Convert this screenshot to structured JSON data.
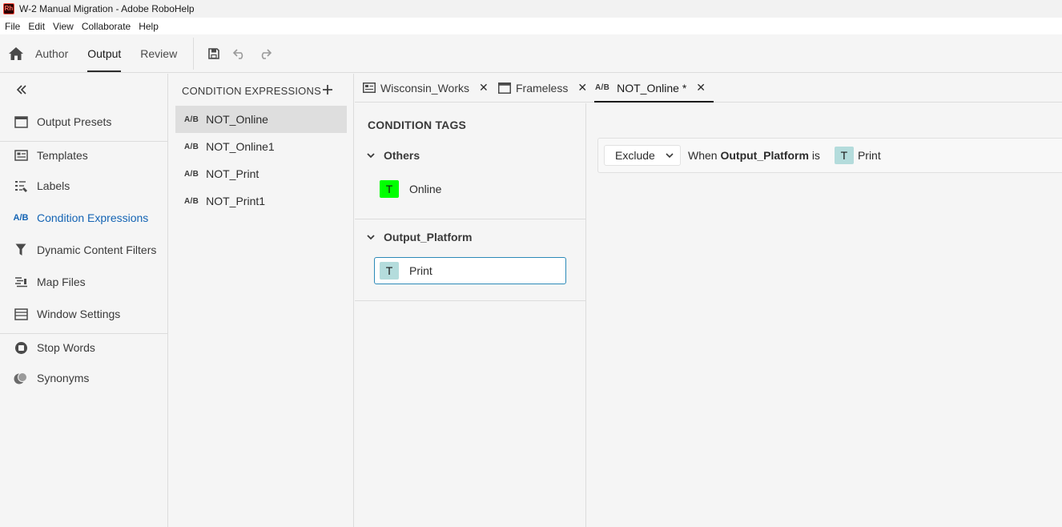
{
  "window": {
    "title": "W-2 Manual Migration - Adobe RoboHelp",
    "logo": "Rh"
  },
  "menu": [
    "File",
    "Edit",
    "View",
    "Collaborate",
    "Help"
  ],
  "toolbar": {
    "tabs": [
      "Author",
      "Output",
      "Review"
    ],
    "active_tab": "Output",
    "icons": [
      "home-icon",
      "save-icon",
      "undo-icon",
      "redo-icon"
    ]
  },
  "left_nav": {
    "items": [
      {
        "label": "Output Presets",
        "icon": "output-presets-icon"
      },
      {
        "label": "Templates",
        "icon": "templates-icon"
      },
      {
        "label": "Labels",
        "icon": "labels-icon"
      },
      {
        "label": "Condition Expressions",
        "icon": "condition-expressions-icon",
        "icon_text": "A/B"
      },
      {
        "label": "Dynamic Content Filters",
        "icon": "filter-icon"
      },
      {
        "label": "Map Files",
        "icon": "map-files-icon"
      },
      {
        "label": "Window Settings",
        "icon": "window-settings-icon"
      },
      {
        "label": "Stop Words",
        "icon": "stop-words-icon"
      },
      {
        "label": "Synonyms",
        "icon": "synonyms-icon"
      }
    ],
    "active": "Condition Expressions"
  },
  "expressions": {
    "header": "CONDITION EXPRESSIONS",
    "ab_label": "A/B",
    "items": [
      "NOT_Online",
      "NOT_Online1",
      "NOT_Print",
      "NOT_Print1"
    ],
    "selected": "NOT_Online"
  },
  "tabs": [
    {
      "label": "Wisconsin_Works",
      "icon": "output-preset-tab-icon"
    },
    {
      "label": "Frameless",
      "icon": "frameless-tab-icon"
    },
    {
      "label": "NOT_Online *",
      "icon": "ab-tab-icon",
      "icon_text": "A/B",
      "active": true
    }
  ],
  "tags_panel": {
    "title": "CONDITION TAGS",
    "tag_letter": "T",
    "groups": [
      {
        "name": "Others",
        "tags": [
          {
            "label": "Online",
            "color": "#00ff00"
          }
        ]
      },
      {
        "name": "Output_Platform",
        "tags": [
          {
            "label": "Print",
            "color": "#b4dcdc",
            "selected": true
          }
        ]
      }
    ]
  },
  "expression_rule": {
    "action": "Exclude",
    "when_prefix": "When",
    "field": "Output_Platform",
    "operator": "is",
    "tag_letter": "T",
    "tag_label": "Print",
    "tag_color": "#b4dcdc"
  },
  "colors": {
    "accent": "#1464b4",
    "selection_border": "#2c8ab8"
  }
}
